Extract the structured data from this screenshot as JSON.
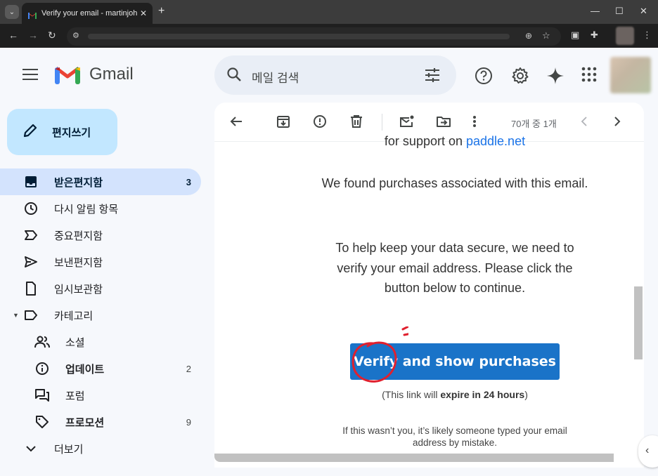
{
  "browser": {
    "tab_title": "Verify your email - martinjohn",
    "tab_close": "✕",
    "new_tab": "+",
    "window_controls": [
      "—",
      "☐",
      "✕"
    ],
    "nav_icons": [
      "←",
      "→",
      "↻"
    ]
  },
  "gmail": {
    "app_name": "Gmail",
    "search_placeholder": "메일 검색",
    "compose_label": "편지쓰기",
    "nav": [
      {
        "label": "받은편지함",
        "icon": "inbox-icon",
        "count": "3",
        "active": true
      },
      {
        "label": "다시 알림 항목",
        "icon": "snooze-icon",
        "count": ""
      },
      {
        "label": "중요편지함",
        "icon": "important-icon",
        "count": ""
      },
      {
        "label": "보낸편지함",
        "icon": "send-icon",
        "count": ""
      },
      {
        "label": "임시보관함",
        "icon": "draft-icon",
        "count": ""
      },
      {
        "label": "카테고리",
        "icon": "label-icon",
        "count": ""
      },
      {
        "label": "소셜",
        "icon": "social-icon",
        "count": ""
      },
      {
        "label": "업데이트",
        "icon": "updates-icon",
        "count": "2"
      },
      {
        "label": "포럼",
        "icon": "forum-icon",
        "count": ""
      },
      {
        "label": "프로모션",
        "icon": "promotions-icon",
        "count": "9"
      },
      {
        "label": "더보기",
        "icon": "expand-icon",
        "count": ""
      }
    ],
    "pager": "70개 중 1개"
  },
  "email": {
    "partial_line_prefix": "for support on ",
    "partial_line_link": "paddle.net",
    "para1": "We found purchases associated with this email.",
    "para2": "To help keep your data secure, we need to verify your email address. Please click the button below to continue.",
    "button_label": "Verify and show purchases",
    "expire_prefix": "(This link will ",
    "expire_bold": "expire in 24 hours",
    "expire_suffix": ")",
    "notice": "If this wasn’t you, it’s likely someone typed your email address by mistake."
  },
  "colors": {
    "accent": "#1a73c8",
    "nav_active": "#d3e3fd",
    "compose_bg": "#c2e7ff",
    "annotation": "#e0202e"
  }
}
